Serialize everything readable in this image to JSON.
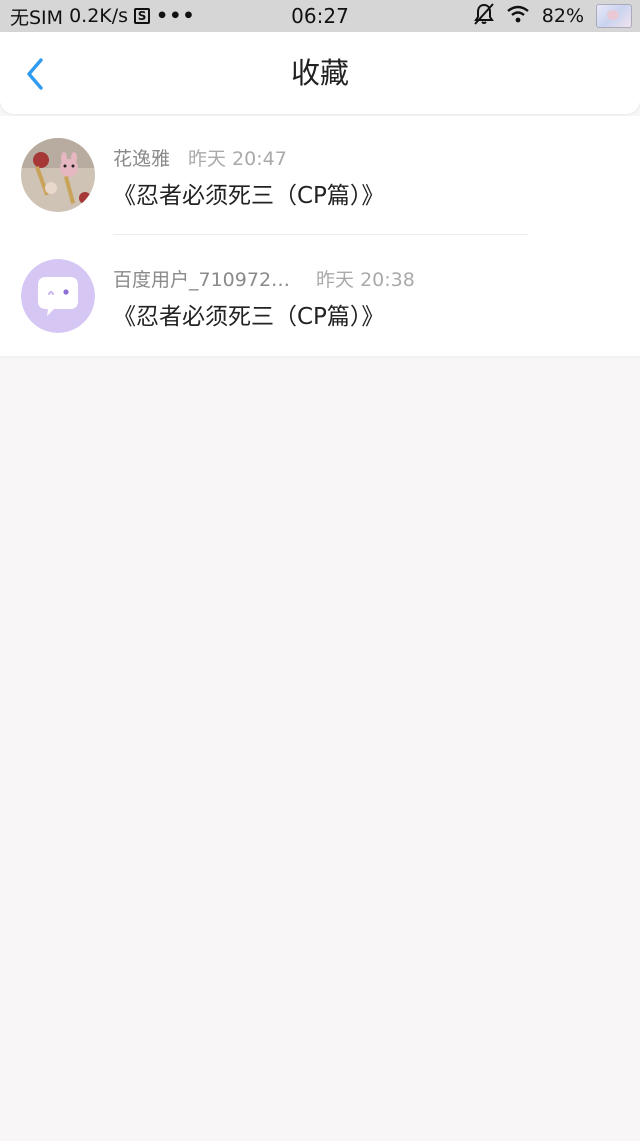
{
  "status_bar": {
    "carrier": "无SIM",
    "speed": "0.2K/s",
    "s_badge": "S",
    "more": "•••",
    "time": "06:27",
    "battery": "82%"
  },
  "header": {
    "title": "收藏",
    "back_icon": "chevron-left-icon",
    "accent_color": "#2f9bf0"
  },
  "favorites": [
    {
      "user": "花逸雅",
      "time": "昨天 20:47",
      "title": "《忍者必须死三（CP篇）》",
      "avatar": "photo-avatar"
    },
    {
      "user": "百度用户_710972…",
      "time": "昨天 20:38",
      "title": "《忍者必须死三（CP篇）》",
      "avatar": "chat-bubble-avatar",
      "avatar_color": "#d5c6f3"
    }
  ]
}
